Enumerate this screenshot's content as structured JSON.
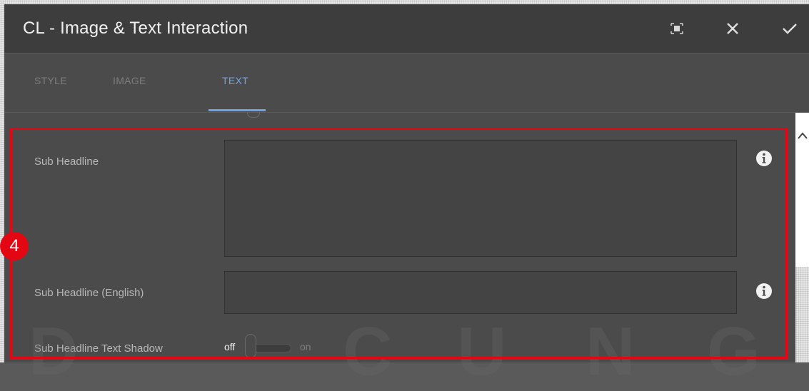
{
  "dialog": {
    "title": "CL - Image & Text Interaction",
    "header_buttons": [
      {
        "name": "fullscreen-icon"
      },
      {
        "name": "close-icon"
      },
      {
        "name": "done-icon"
      }
    ]
  },
  "tabs": [
    {
      "label": "STYLE",
      "active": false
    },
    {
      "label": "IMAGE",
      "active": false
    },
    {
      "label": "TEXT",
      "active": true
    }
  ],
  "fields": {
    "sub_headline": {
      "label": "Sub Headline",
      "value": ""
    },
    "sub_headline_english": {
      "label": "Sub Headline (English)",
      "value": ""
    },
    "sub_headline_text_shadow": {
      "label": "Sub Headline Text Shadow",
      "off_label": "off",
      "on_label": "on",
      "state": "off"
    }
  },
  "annotation": {
    "step_number": "4"
  },
  "colors": {
    "accent": "#6fa3e8",
    "highlight": "#e30613",
    "dialog_bg": "#4b4b4b",
    "header_bg": "#3d3d3d"
  }
}
